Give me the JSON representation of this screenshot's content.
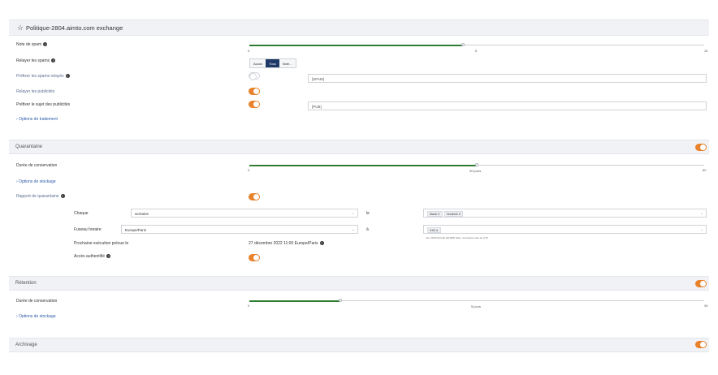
{
  "title_bar": {
    "title": "Politique-2804.aimto.com exchange"
  },
  "spam": {
    "note_label": "Note de spam",
    "note_min": "0",
    "note_value": "5",
    "note_max": "10",
    "note_fraction": 0.47,
    "relayer_spams_label": "Relayer les spams",
    "relayer_options": [
      "Aucun",
      "Tous",
      "Note..."
    ],
    "relayer_selected": "Tous",
    "prefixer_spams_label": "Préfixer les spams relayés",
    "prefixer_spams_value": "[SPAM]",
    "relayer_pubs_label": "Relayer les publicités",
    "prefixer_pubs_label": "Préfixer le sujet des publicités",
    "prefixer_pubs_value": "[PUB]",
    "options_link": "Options de traitement"
  },
  "quarantaine": {
    "title": "Quarantaine",
    "duree_label": "Durée de conservation",
    "duree_min": "0",
    "duree_value": "30 jours",
    "duree_max": "60",
    "duree_fraction": 0.5,
    "options_stockage_link": "Options de stockage",
    "rapport_label": "Rapport de quarantaine",
    "chaque_label": "Chaque",
    "chaque_value": "semaine",
    "le_label": "le",
    "jours_chips": [
      "Mardi ✕",
      "Vendredi ✕"
    ],
    "fuseau_label": "Fuseau horaire",
    "fuseau_value": "Europe/Paris",
    "a_label": "à",
    "heure_chips": [
      "9:00 ✕"
    ],
    "heure_hint": "Ex. 09:00 (format HH:MM) Note : les heures sont en UTC (ex: 09:00 UTC = 10:00 CET)",
    "prochaine_label": "Prochaine exécution prévue le",
    "prochaine_value": "27 décembre 2022 11:00 Europe/Paris",
    "acces_label": "Accès authentifié"
  },
  "retention": {
    "title": "Rétention",
    "duree_label": "Durée de conservation",
    "duree_min": "0",
    "duree_value": "5 jours",
    "duree_max": "30",
    "duree_fraction": 0.2,
    "options_stockage_link": "Options de stockage"
  },
  "archivage": {
    "title": "Archivage"
  },
  "colors": {
    "accent": "#e8832c",
    "slider_fill": "#2e7d32",
    "segment_active": "#1f3a67"
  },
  "icons": {
    "title": "star-icon",
    "help": "question-circle-icon",
    "collapse": "chevron-right-icon",
    "dropdown": "chevron-down-icon"
  }
}
